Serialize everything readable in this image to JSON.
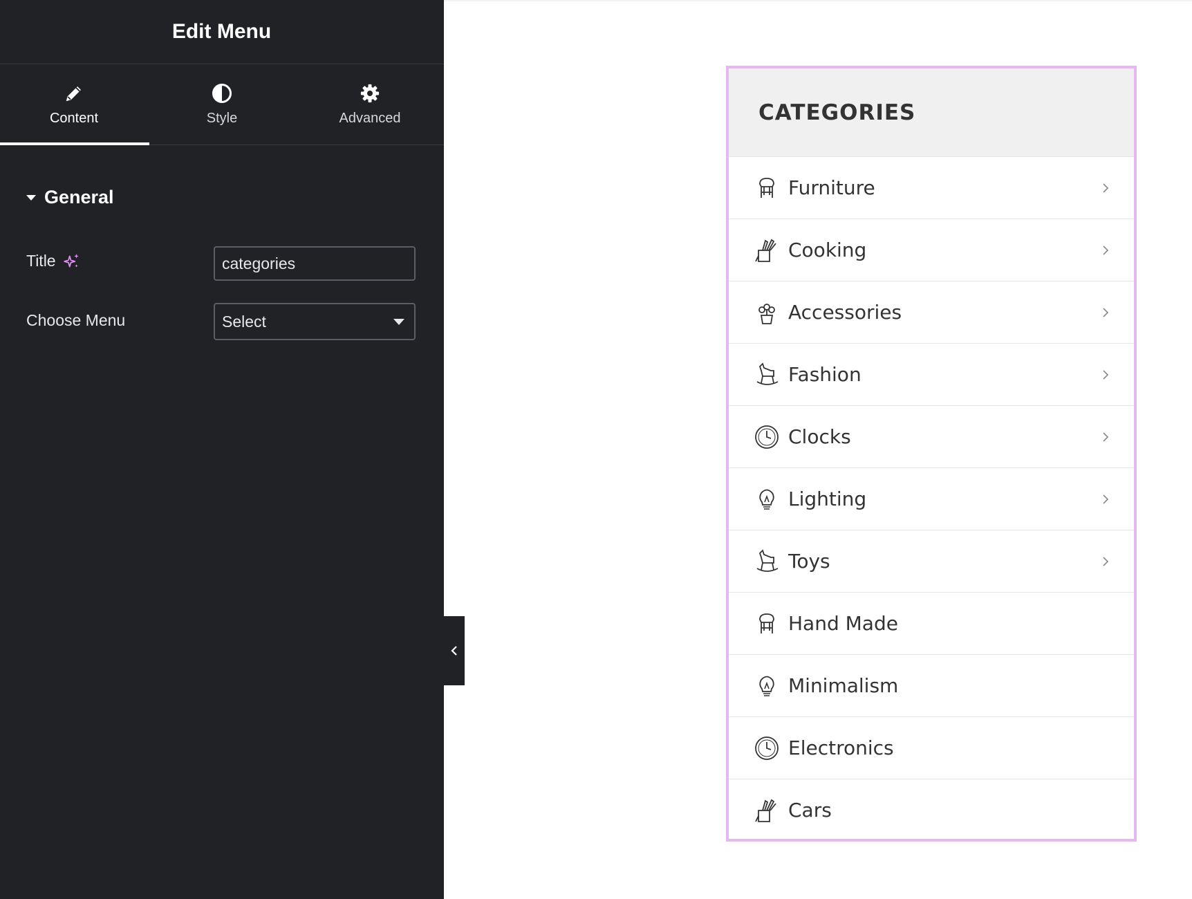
{
  "panel": {
    "title": "Edit Menu",
    "tabs": [
      {
        "label": "Content",
        "icon": "pencil-icon",
        "active": true
      },
      {
        "label": "Style",
        "icon": "contrast-icon",
        "active": false
      },
      {
        "label": "Advanced",
        "icon": "gear-icon",
        "active": false
      }
    ],
    "section": {
      "title": "General",
      "expanded": true
    },
    "fields": {
      "title_label": "Title",
      "title_value": "categories",
      "menu_label": "Choose Menu",
      "menu_value": "Select"
    }
  },
  "widget": {
    "title": "CATEGORIES",
    "items": [
      {
        "label": "Furniture",
        "icon": "chair-icon",
        "has_submenu": true
      },
      {
        "label": "Cooking",
        "icon": "knife-block-icon",
        "has_submenu": true
      },
      {
        "label": "Accessories",
        "icon": "flower-pot-icon",
        "has_submenu": true
      },
      {
        "label": "Fashion",
        "icon": "rocking-horse-icon",
        "has_submenu": true
      },
      {
        "label": "Clocks",
        "icon": "clock-icon",
        "has_submenu": true
      },
      {
        "label": "Lighting",
        "icon": "light-bulb-icon",
        "has_submenu": true
      },
      {
        "label": "Toys",
        "icon": "rocking-horse-icon",
        "has_submenu": true
      },
      {
        "label": "Hand Made",
        "icon": "chair-icon",
        "has_submenu": false
      },
      {
        "label": "Minimalism",
        "icon": "light-bulb-icon",
        "has_submenu": false
      },
      {
        "label": "Electronics",
        "icon": "clock-icon",
        "has_submenu": false
      },
      {
        "label": "Cars",
        "icon": "knife-block-icon",
        "has_submenu": false
      }
    ]
  },
  "colors": {
    "panel_bg": "#212226",
    "widget_border": "#e5b8f0",
    "sparkle": "#e28ef5",
    "widget_head_bg": "#f0f0f0"
  }
}
